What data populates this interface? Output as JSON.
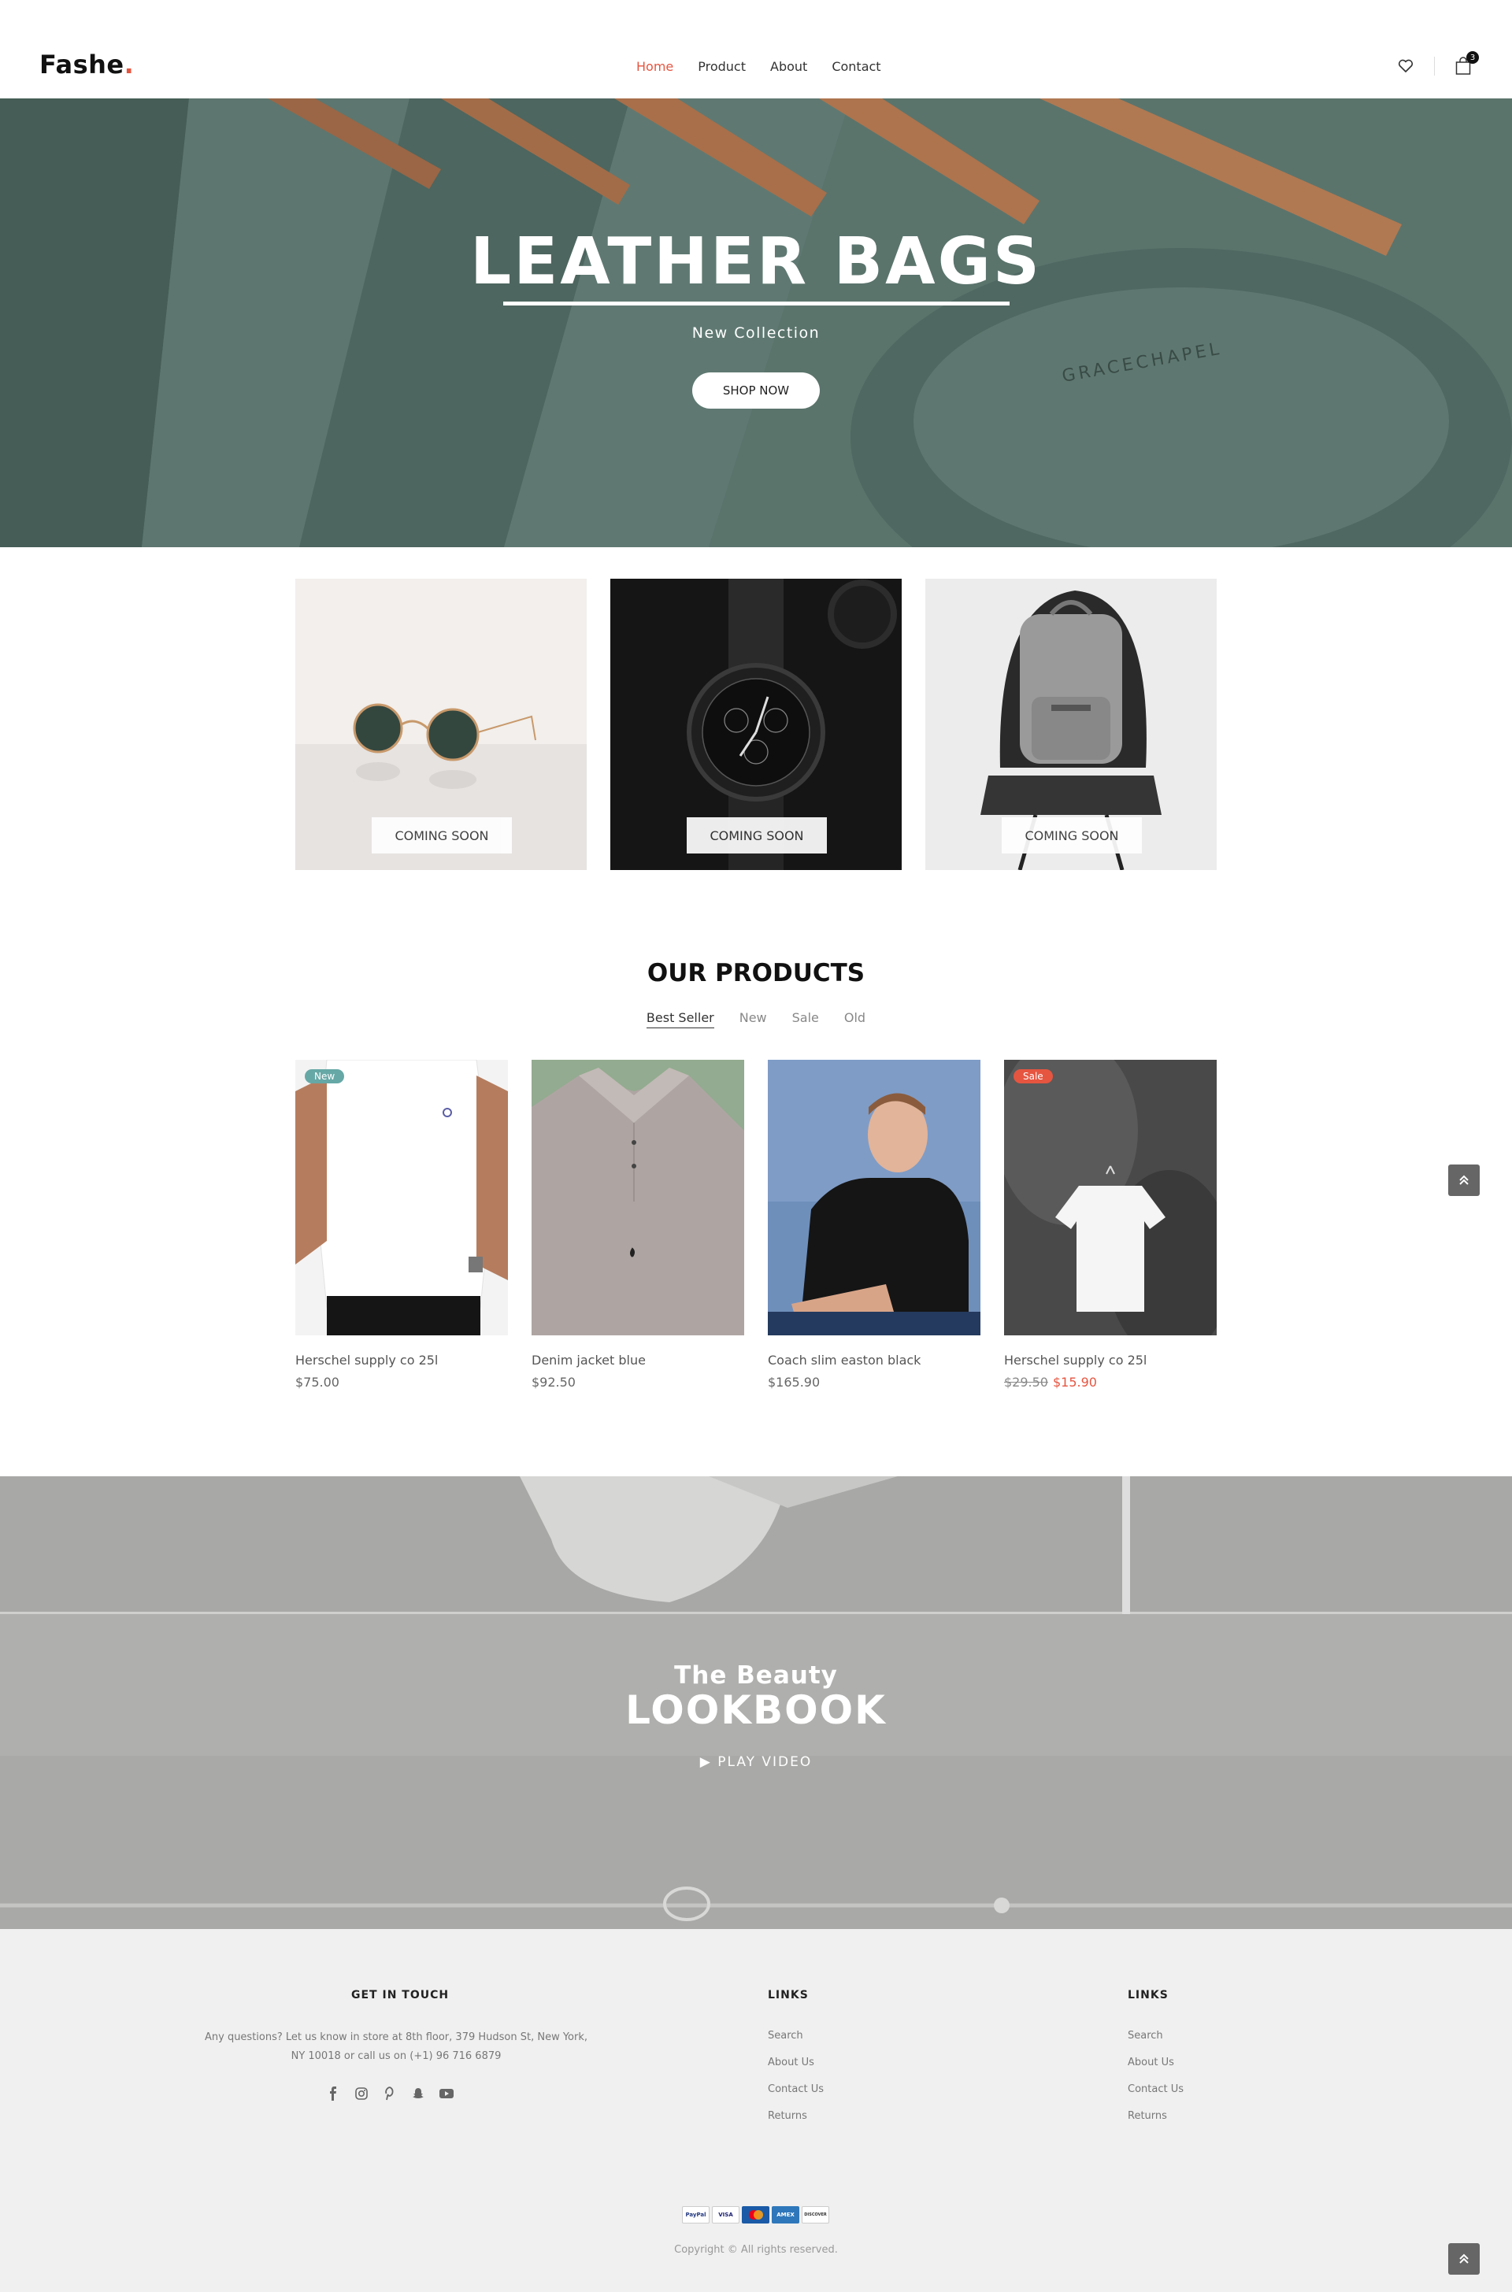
{
  "header": {
    "logo_text": "Fashe",
    "logo_dot": ".",
    "nav": [
      {
        "label": "Home",
        "active": true
      },
      {
        "label": "Product",
        "active": false
      },
      {
        "label": "About",
        "active": false
      },
      {
        "label": "Contact",
        "active": false
      }
    ],
    "cart_count": "3",
    "icons": [
      "heart-icon",
      "shopping-bag-icon"
    ]
  },
  "hero": {
    "title": "LEATHER BAGS",
    "subtitle": "New Collection",
    "button": "SHOP NOW"
  },
  "banners": [
    {
      "subject": "sunglasses",
      "label": "COMING SOON"
    },
    {
      "subject": "watch",
      "label": "COMING SOON"
    },
    {
      "subject": "backpack",
      "label": "COMING SOON"
    }
  ],
  "products_section": {
    "title": "OUR PRODUCTS",
    "filters": [
      "Best Seller",
      "New",
      "Sale",
      "Old"
    ],
    "active_filter": "Best Seller",
    "items": [
      {
        "name": "Herschel supply co 25l",
        "price": "$75.00",
        "tag": "New"
      },
      {
        "name": "Denim jacket blue",
        "price": "$92.50",
        "tag": ""
      },
      {
        "name": "Coach slim easton black",
        "price": "$165.90",
        "tag": ""
      },
      {
        "name": "Herschel supply co 25l",
        "old_price": "$29.50",
        "price": "$15.90",
        "tag": "Sale"
      }
    ]
  },
  "lookbook": {
    "subtitle": "The Beauty",
    "title": "LOOKBOOK",
    "play": "PLAY VIDEO"
  },
  "footer": {
    "contact_title": "GET IN TOUCH",
    "contact_line1": "Any questions? Let us know in store at 8th floor, 379 Hudson St, New York,",
    "contact_line2": "NY 10018 or call us on (+1) 96 716 6879",
    "social": [
      "facebook-icon",
      "instagram-icon",
      "pinterest-icon",
      "snapchat-icon",
      "youtube-icon"
    ],
    "links1_title": "LINKS",
    "links1": [
      "Search",
      "About Us",
      "Contact Us",
      "Returns"
    ],
    "links2_title": "LINKS",
    "links2": [
      "Search",
      "About Us",
      "Contact Us",
      "Returns"
    ],
    "payments": [
      "PayPal",
      "VISA",
      "MC",
      "AMEX",
      "DISCOVER"
    ],
    "copyright": "Copyright © All rights reserved."
  },
  "colors": {
    "accent": "#e65540",
    "new_tag": "#66a8a6",
    "sale_tag": "#e65540",
    "footer_bg": "#f0f0f0"
  }
}
